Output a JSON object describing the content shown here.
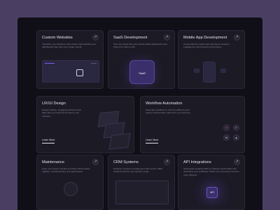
{
  "cards": [
    {
      "title": "Custom Websites",
      "desc": "Transform your business with custom-built websites and dashboards that meet your unique needs.",
      "arrow": "↗"
    },
    {
      "title": "SaaS Development",
      "desc": "Turn your ideas into user-friendly SaaS applications that bring your vision to life.",
      "arrow": "↗",
      "badge": "SaaS"
    },
    {
      "title": "Mobile App Development",
      "desc": "Create tailored mobile apps that boost customer engagement and business performance.",
      "arrow": "↗"
    },
    {
      "title": "UX/UI Design",
      "desc": "Design intuitive, engaging interfaces that align with your brand and improve user retention.",
      "arrow": "↗",
      "learn": "Learn More"
    },
    {
      "title": "Workflow Automation",
      "desc": "Automate workflows to improve efficiency and reduce manual tasks, tailored to your business.",
      "arrow": "↗",
      "learn": "Learn More"
    },
    {
      "title": "Maintenance",
      "desc": "Keep your system running smoothly with proactive updates, troubleshooting, and optimization.",
      "arrow": "↗"
    },
    {
      "title": "CRM Systems",
      "desc": "Enhance customer management with custom CRM solutions built for your specific needs.",
      "arrow": "↗"
    },
    {
      "title": "API Integrations",
      "desc": "Seamlessly integrate APIs to enhance functionality and streamline your workflows. Watch your processes become more efficient!",
      "arrow": "↗",
      "badge": "API"
    }
  ],
  "colors": {
    "accent": "#7b5cf5",
    "card_bg": "#1c1a25",
    "page_bg": "#100e16",
    "outer_bg": "#4a3f63"
  },
  "icons": [
    "monitor-icon",
    "cloud-icon",
    "phone-icon",
    "layers-icon",
    "app-icons",
    "gear-icon",
    "grid-icon",
    "chip-icon"
  ]
}
